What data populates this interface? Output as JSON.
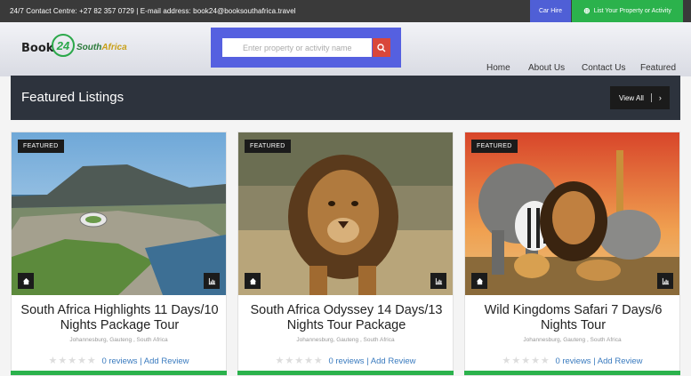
{
  "topbar": {
    "contact": "24/7 Contact Centre: +27 82 357 0729 | E-mail address: book24@booksouthafrica.travel",
    "car_hire": "Car Hire",
    "list_property": "List Your Property or Activity"
  },
  "logo": {
    "book": "Book",
    "num": "24",
    "south": "South",
    "africa": "Africa"
  },
  "search": {
    "placeholder": "Enter property or activity name"
  },
  "nav": [
    "Home",
    "About Us",
    "Contact Us",
    "Featured"
  ],
  "banner": {
    "title": "Featured Listings",
    "view_all": "View All"
  },
  "cards": [
    {
      "badge": "FEATURED",
      "title": "South Africa Highlights 11 Days/10 Nights Package Tour",
      "location": "Johannesburg, Gauteng , South Africa",
      "reviews": "0 reviews",
      "add_review": "Add Review"
    },
    {
      "badge": "FEATURED",
      "title": "South Africa Odyssey 14 Days/13 Nights Tour Package",
      "location": "Johannesburg, Gauteng , South Africa",
      "reviews": "0 reviews",
      "add_review": "Add Review"
    },
    {
      "badge": "FEATURED",
      "title": "Wild Kingdoms Safari 7 Days/6 Nights Tour",
      "location": "Johannesburg, Gauteng , South Africa",
      "reviews": "0 reviews",
      "add_review": "Add Review"
    }
  ],
  "colors": {
    "green": "#2bb24c",
    "blue": "#5560e0",
    "dark": "#2d333d",
    "red": "#d9473b"
  }
}
